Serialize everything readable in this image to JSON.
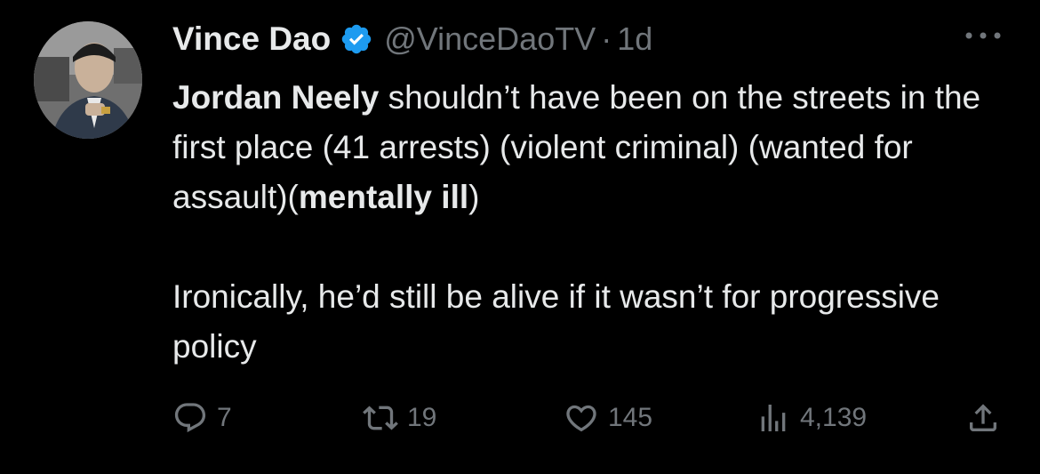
{
  "tweet": {
    "author": {
      "name": "Vince Dao",
      "handle": "@VinceDaoTV",
      "verified": true,
      "avatar_icon": "profile-photo"
    },
    "separator": "·",
    "timestamp": "1d",
    "body": {
      "p1": {
        "bold_start": "Jordan Neely",
        "text_mid": " shouldn’t have been on the streets in the first place (41 arrests) (violent criminal) (wanted for assault)(",
        "bold_end": "mentally ill",
        "text_end": ")"
      },
      "p2": "Ironically, he’d still be alive if it wasn’t for progressive policy"
    },
    "actions": {
      "replies": "7",
      "retweets": "19",
      "likes": "145",
      "views": "4,139"
    }
  },
  "colors": {
    "background": "#000000",
    "text_primary": "#e7e9ea",
    "text_secondary": "#71767b",
    "verified_blue": "#1d9bf0"
  },
  "icons": {
    "verified": "verified-badge-icon",
    "more": "more-options-icon",
    "reply": "reply-icon",
    "retweet": "retweet-icon",
    "like": "heart-icon",
    "views": "views-chart-icon",
    "share": "share-icon"
  }
}
